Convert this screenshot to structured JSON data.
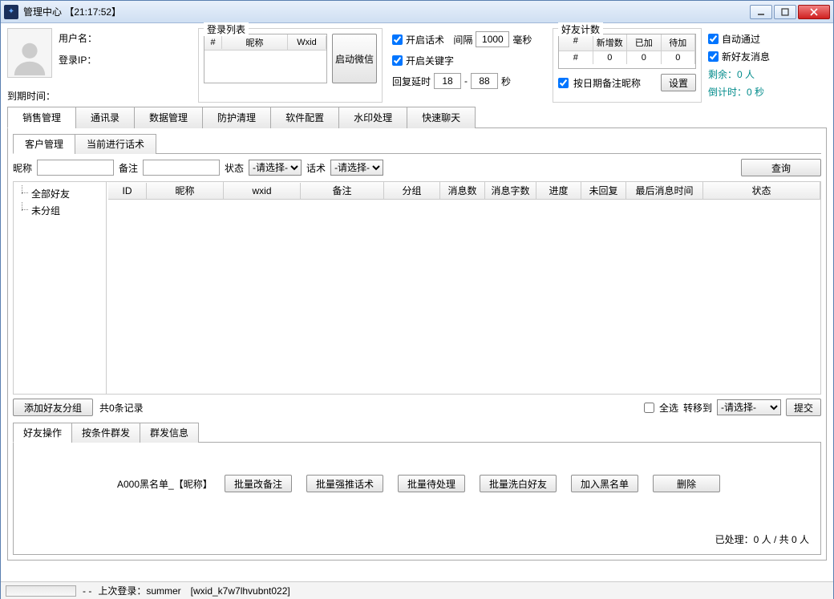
{
  "window": {
    "title": "管理中心 【21:17:52】"
  },
  "user": {
    "name_label": "用户名：",
    "ip_label": "登录IP：",
    "expire_label": "到期时间："
  },
  "loginlist": {
    "legend": "登录列表",
    "cols": {
      "c0": "#",
      "c1": "昵称",
      "c2": "Wxid"
    },
    "start_btn": "启动微信"
  },
  "midopts": {
    "enable_script": "开启话术",
    "interval_label": "间隔",
    "interval_value": "1000",
    "interval_unit": "毫秒",
    "enable_keyword": "开启关键字",
    "reply_delay_label": "回复延时",
    "delay_from": "18",
    "delay_to": "88",
    "delay_unit": "秒"
  },
  "friendcount": {
    "legend": "好友计数",
    "cols": {
      "c0": "#",
      "c1": "新增数",
      "c2": "已加",
      "c3": "待加"
    },
    "row": {
      "c0": "#",
      "c1": "0",
      "c2": "0",
      "c3": "0"
    },
    "remark_by_date": "按日期备注昵称",
    "settings_btn": "设置"
  },
  "rightopts": {
    "auto_pass": "自动通过",
    "new_friend_msg": "新好友消息",
    "remain": "剩余：0 人",
    "countdown": "倒计时：0 秒"
  },
  "maintabs": {
    "t0": "销售管理",
    "t1": "通讯录",
    "t2": "数据管理",
    "t3": "防护清理",
    "t4": "软件配置",
    "t5": "水印处理",
    "t6": "快速聊天"
  },
  "subtabs": {
    "s0": "客户管理",
    "s1": "当前进行话术"
  },
  "filter": {
    "nick_label": "昵称",
    "remark_label": "备注",
    "status_label": "状态",
    "status_placeholder": "-请选择-",
    "script_label": "话术",
    "script_placeholder": "-请选择-",
    "query_btn": "查询"
  },
  "tree": {
    "n0": "全部好友",
    "n1": "未分组"
  },
  "gridcols": {
    "c0": "ID",
    "c1": "昵称",
    "c2": "wxid",
    "c3": "备注",
    "c4": "分组",
    "c5": "消息数",
    "c6": "消息字数",
    "c7": "进度",
    "c8": "未回复",
    "c9": "最后消息时间",
    "c10": "状态"
  },
  "bottom1": {
    "add_group_btn": "添加好友分组",
    "total": "共0条记录",
    "select_all": "全选",
    "move_to": "转移到",
    "move_placeholder": "-请选择-",
    "submit": "提交"
  },
  "optabs": {
    "o0": "好友操作",
    "o1": "按条件群发",
    "o2": "群发信息"
  },
  "ops": {
    "blacklist_template": "A000黑名单_【昵称】",
    "b0": "批量改备注",
    "b1": "批量强推话术",
    "b2": "批量待处理",
    "b3": "批量洗白好友",
    "b4": "加入黑名单",
    "b5": "删除",
    "status": "已处理：0 人 / 共 0 人"
  },
  "statusbar": {
    "sep": "- -",
    "last_login": "上次登录：summer　[wxid_k7w7lhvubnt022]"
  }
}
